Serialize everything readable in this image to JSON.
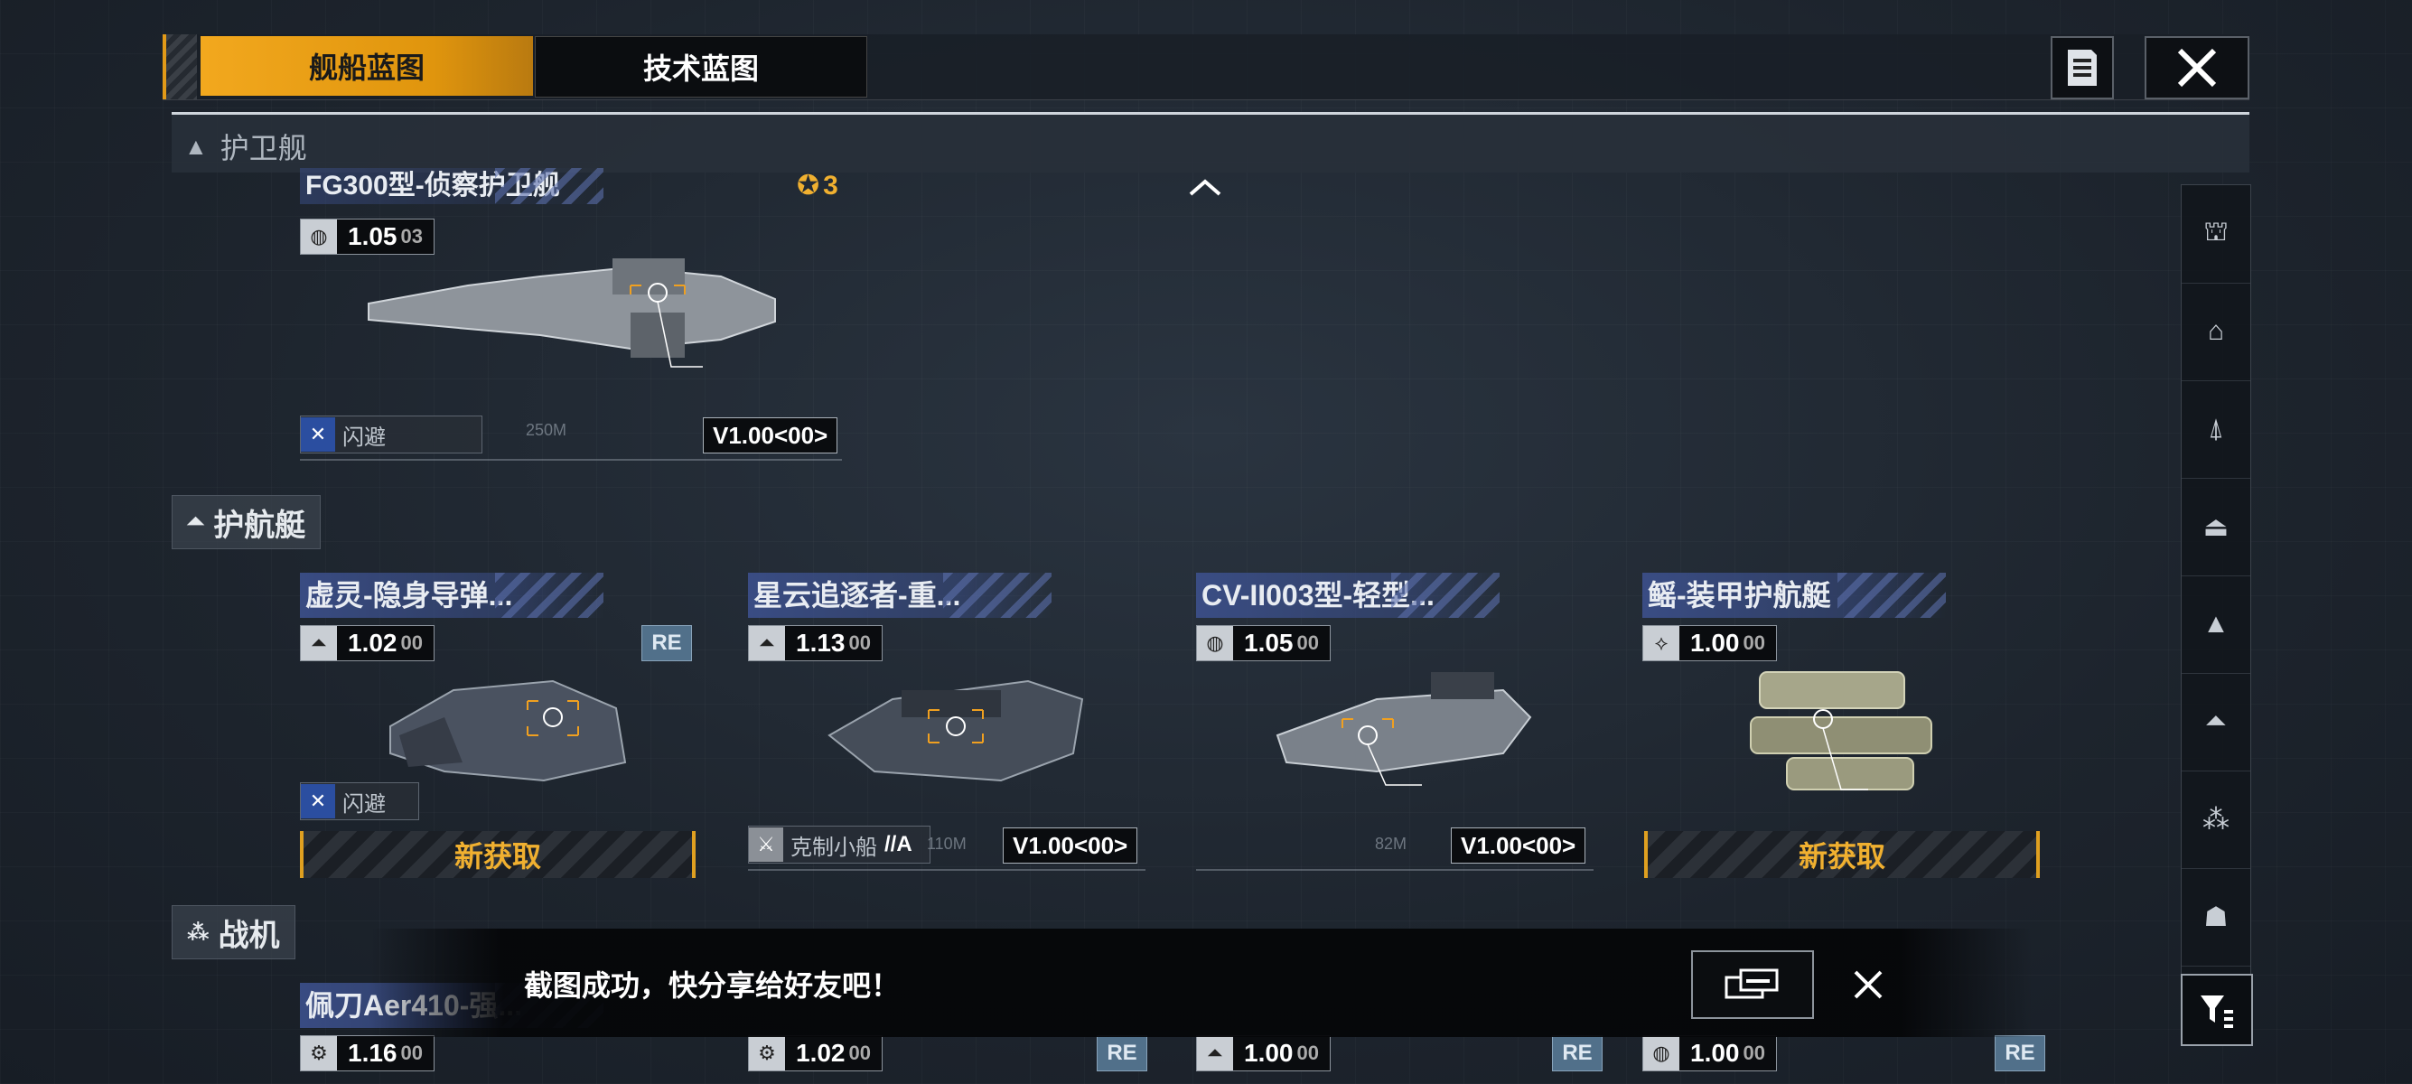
{
  "tabs": [
    {
      "label": "舰船蓝图",
      "active": true
    },
    {
      "label": "技术蓝图",
      "active": false
    }
  ],
  "sections": {
    "frigate": {
      "label": "护卫舰"
    },
    "corvette": {
      "label": "护航艇"
    },
    "fighter": {
      "label": "战机"
    }
  },
  "frigate_card": {
    "title": "FG300型-侦察护卫舰",
    "medal_count": "3",
    "version": "1.05",
    "version_sub": "03",
    "tag": "闪避",
    "build": "V1.00<00>",
    "scale": "250M"
  },
  "corvettes": [
    {
      "title": "虚灵-隐身导弹...",
      "version": "1.02",
      "version_sub": "00",
      "re": "RE",
      "tag": "闪避",
      "action": "新获取"
    },
    {
      "title": "星云追逐者-重...",
      "version": "1.13",
      "version_sub": "00",
      "tag": "克制小船",
      "tag_suffix": "//A",
      "build": "V1.00<00>",
      "scale": "110M"
    },
    {
      "title": "CV-II003型-轻型...",
      "version": "1.05",
      "version_sub": "00",
      "build": "V1.00<00>",
      "scale": "82M"
    },
    {
      "title": "鳐-装甲护航艇",
      "version": "1.00",
      "version_sub": "00",
      "action": "新获取"
    }
  ],
  "fighters": [
    {
      "title": "佩刀Aer410-强...",
      "version": "1.16",
      "version_sub": "00"
    },
    {
      "title": "",
      "version": "1.02",
      "version_sub": "00",
      "re": "RE"
    },
    {
      "title": "",
      "version": "1.00",
      "version_sub": "00",
      "re": "RE"
    },
    {
      "title": "",
      "version": "1.00",
      "version_sub": "00",
      "re": "RE"
    }
  ],
  "toast": {
    "message": "截图成功，快分享给好友吧！"
  },
  "sidebar_icons": [
    "battleship-icon",
    "carrier-icon",
    "cruiser-icon",
    "destroyer-icon",
    "frigate-icon",
    "corvette-icon",
    "fighter-icon",
    "auxiliary-icon"
  ],
  "colors": {
    "accent": "#f2a81e",
    "title_blue": "#3c508c",
    "re_badge": "#51708a"
  }
}
